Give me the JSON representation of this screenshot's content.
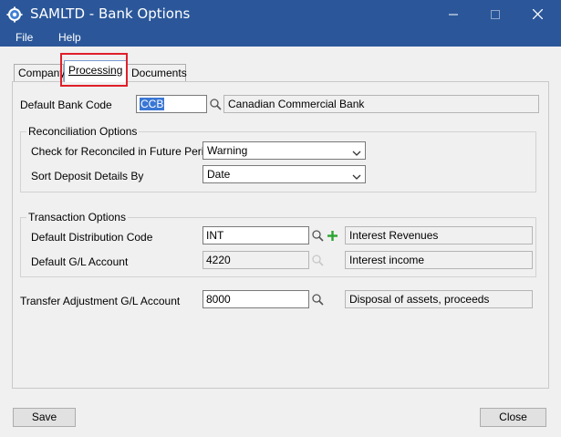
{
  "window": {
    "title": "SAMLTD - Bank Options"
  },
  "menu": {
    "file": "File",
    "help": "Help"
  },
  "tabs": [
    {
      "label": "Company"
    },
    {
      "label": "Processing"
    },
    {
      "label": "Documents"
    }
  ],
  "default_bank": {
    "label": "Default Bank Code",
    "value": "CCB",
    "description": "Canadian Commercial Bank"
  },
  "reconciliation": {
    "title": "Reconciliation Options",
    "future_label": "Check for Reconciled in Future Periods",
    "future_value": "Warning",
    "sort_label": "Sort Deposit Details By",
    "sort_value": "Date"
  },
  "transaction": {
    "title": "Transaction Options",
    "dist_label": "Default Distribution Code",
    "dist_value": "INT",
    "dist_description": "Interest Revenues",
    "gl_label": "Default G/L Account",
    "gl_value": "4220",
    "gl_description": "Interest income"
  },
  "transfer": {
    "label": "Transfer Adjustment G/L Account",
    "value": "8000",
    "description": "Disposal of assets, proceeds"
  },
  "buttons": {
    "save": "Save",
    "close": "Close"
  },
  "colors": {
    "titlebar": "#2b579a",
    "highlight": "#e0202a",
    "selection": "#3a77d4",
    "plus": "#2aa531"
  }
}
